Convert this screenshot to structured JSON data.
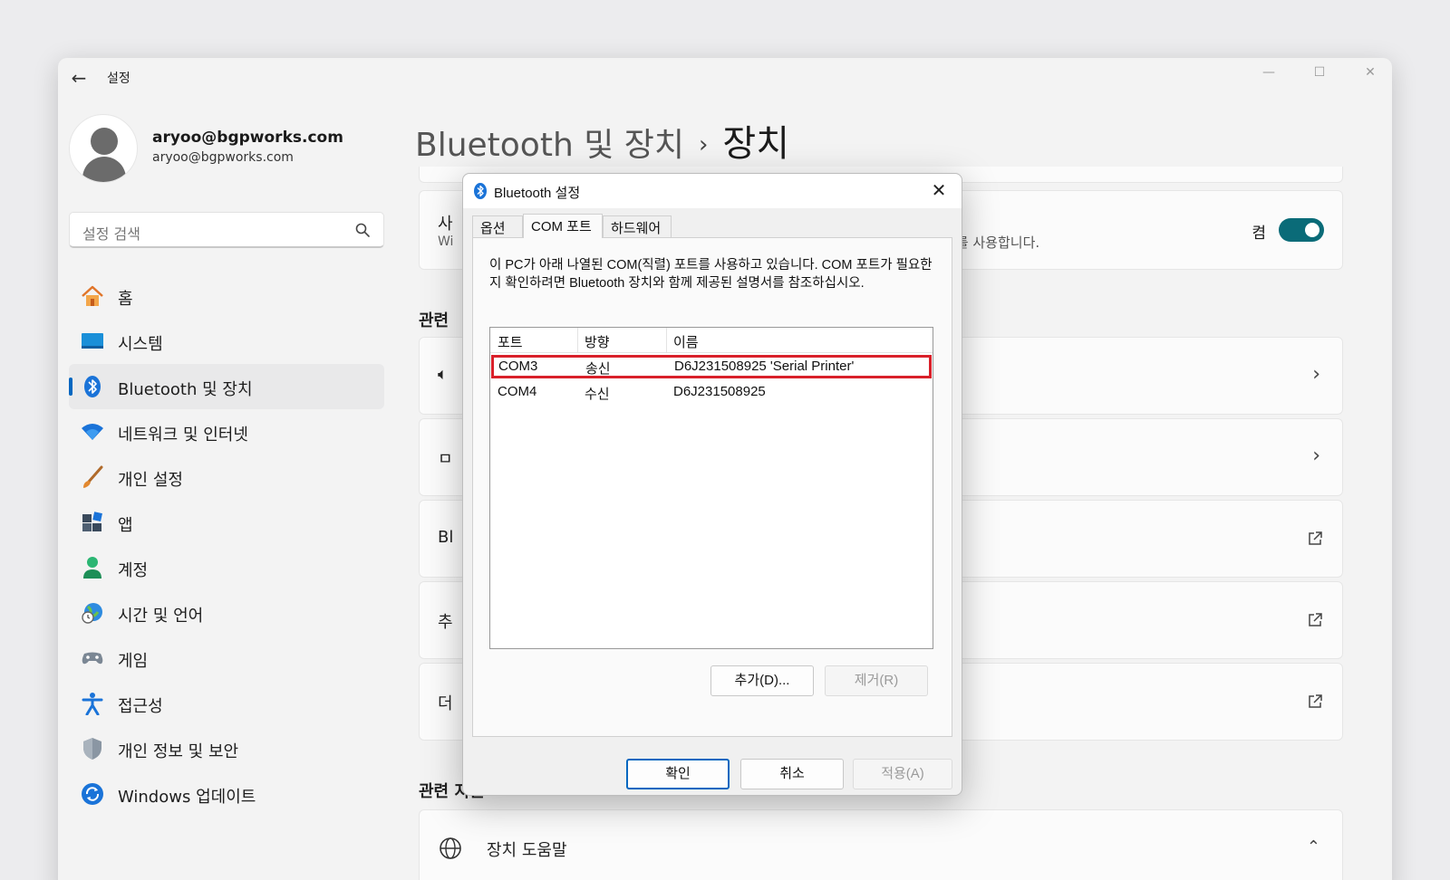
{
  "window": {
    "title": "설정",
    "back_glyph": "←",
    "controls": {
      "minimize": "—",
      "maximize": "☐",
      "close": "✕"
    }
  },
  "profile": {
    "name": "aryoo@bgpworks.com",
    "email": "aryoo@bgpworks.com"
  },
  "search": {
    "placeholder": "설정 검색"
  },
  "nav": {
    "items": [
      {
        "label": "홈",
        "icon": "home-icon"
      },
      {
        "label": "시스템",
        "icon": "system-icon"
      },
      {
        "label": "Bluetooth 및 장치",
        "icon": "bluetooth-icon",
        "active": true
      },
      {
        "label": "네트워크 및 인터넷",
        "icon": "wifi-icon"
      },
      {
        "label": "개인 설정",
        "icon": "brush-icon"
      },
      {
        "label": "앱",
        "icon": "apps-icon"
      },
      {
        "label": "계정",
        "icon": "account-icon"
      },
      {
        "label": "시간 및 언어",
        "icon": "globe-clock-icon"
      },
      {
        "label": "게임",
        "icon": "gamepad-icon"
      },
      {
        "label": "접근성",
        "icon": "accessibility-icon"
      },
      {
        "label": "개인 정보 및 보안",
        "icon": "shield-icon"
      },
      {
        "label": "Windows 업데이트",
        "icon": "update-icon"
      }
    ]
  },
  "header": {
    "parent": "Bluetooth 및 장치",
    "separator": "›",
    "current": "장치"
  },
  "main": {
    "bluetooth_card": {
      "label_fragment": "사",
      "sub_fragment": "Wi",
      "desc_fragment": "오를 사용합니다.",
      "toggle_label": "켬",
      "toggle_on": true
    },
    "related_settings_fragment": "관련",
    "cards": [
      {
        "fragment": "🔈︎",
        "kind": "chevron"
      },
      {
        "fragment": "ㅁ",
        "kind": "chevron"
      },
      {
        "fragment": "Bl",
        "kind": "external"
      },
      {
        "fragment": "추",
        "kind": "external"
      },
      {
        "fragment": "더",
        "kind": "external"
      }
    ],
    "chevron_glyph": "›",
    "related_support": "관련 지원",
    "device_help": {
      "label": "장치 도움말",
      "chevron": "⌃"
    }
  },
  "dialog": {
    "title": "Bluetooth 설정",
    "close_glyph": "✕",
    "tabs": [
      {
        "label": "옵션"
      },
      {
        "label": "COM 포트",
        "active": true
      },
      {
        "label": "하드웨어"
      }
    ],
    "description": "이 PC가 아래 나열된 COM(직렬) 포트를 사용하고 있습니다. COM 포트가 필요한지 확인하려면 Bluetooth 장치와 함께 제공된 설명서를 참조하십시오.",
    "columns": {
      "port": "포트",
      "direction": "방향",
      "name": "이름"
    },
    "rows": [
      {
        "port": "COM3",
        "direction": "송신",
        "name": "D6J231508925 'Serial Printer'",
        "highlighted": true
      },
      {
        "port": "COM4",
        "direction": "수신",
        "name": "D6J231508925"
      }
    ],
    "buttons": {
      "add": "추가(D)...",
      "remove": "제거(R)",
      "ok": "확인",
      "cancel": "취소",
      "apply": "적용(A)"
    }
  },
  "colors": {
    "accent": "#0067c0",
    "toggle_on": "#0a6b78",
    "highlight_border": "#d9202a"
  }
}
